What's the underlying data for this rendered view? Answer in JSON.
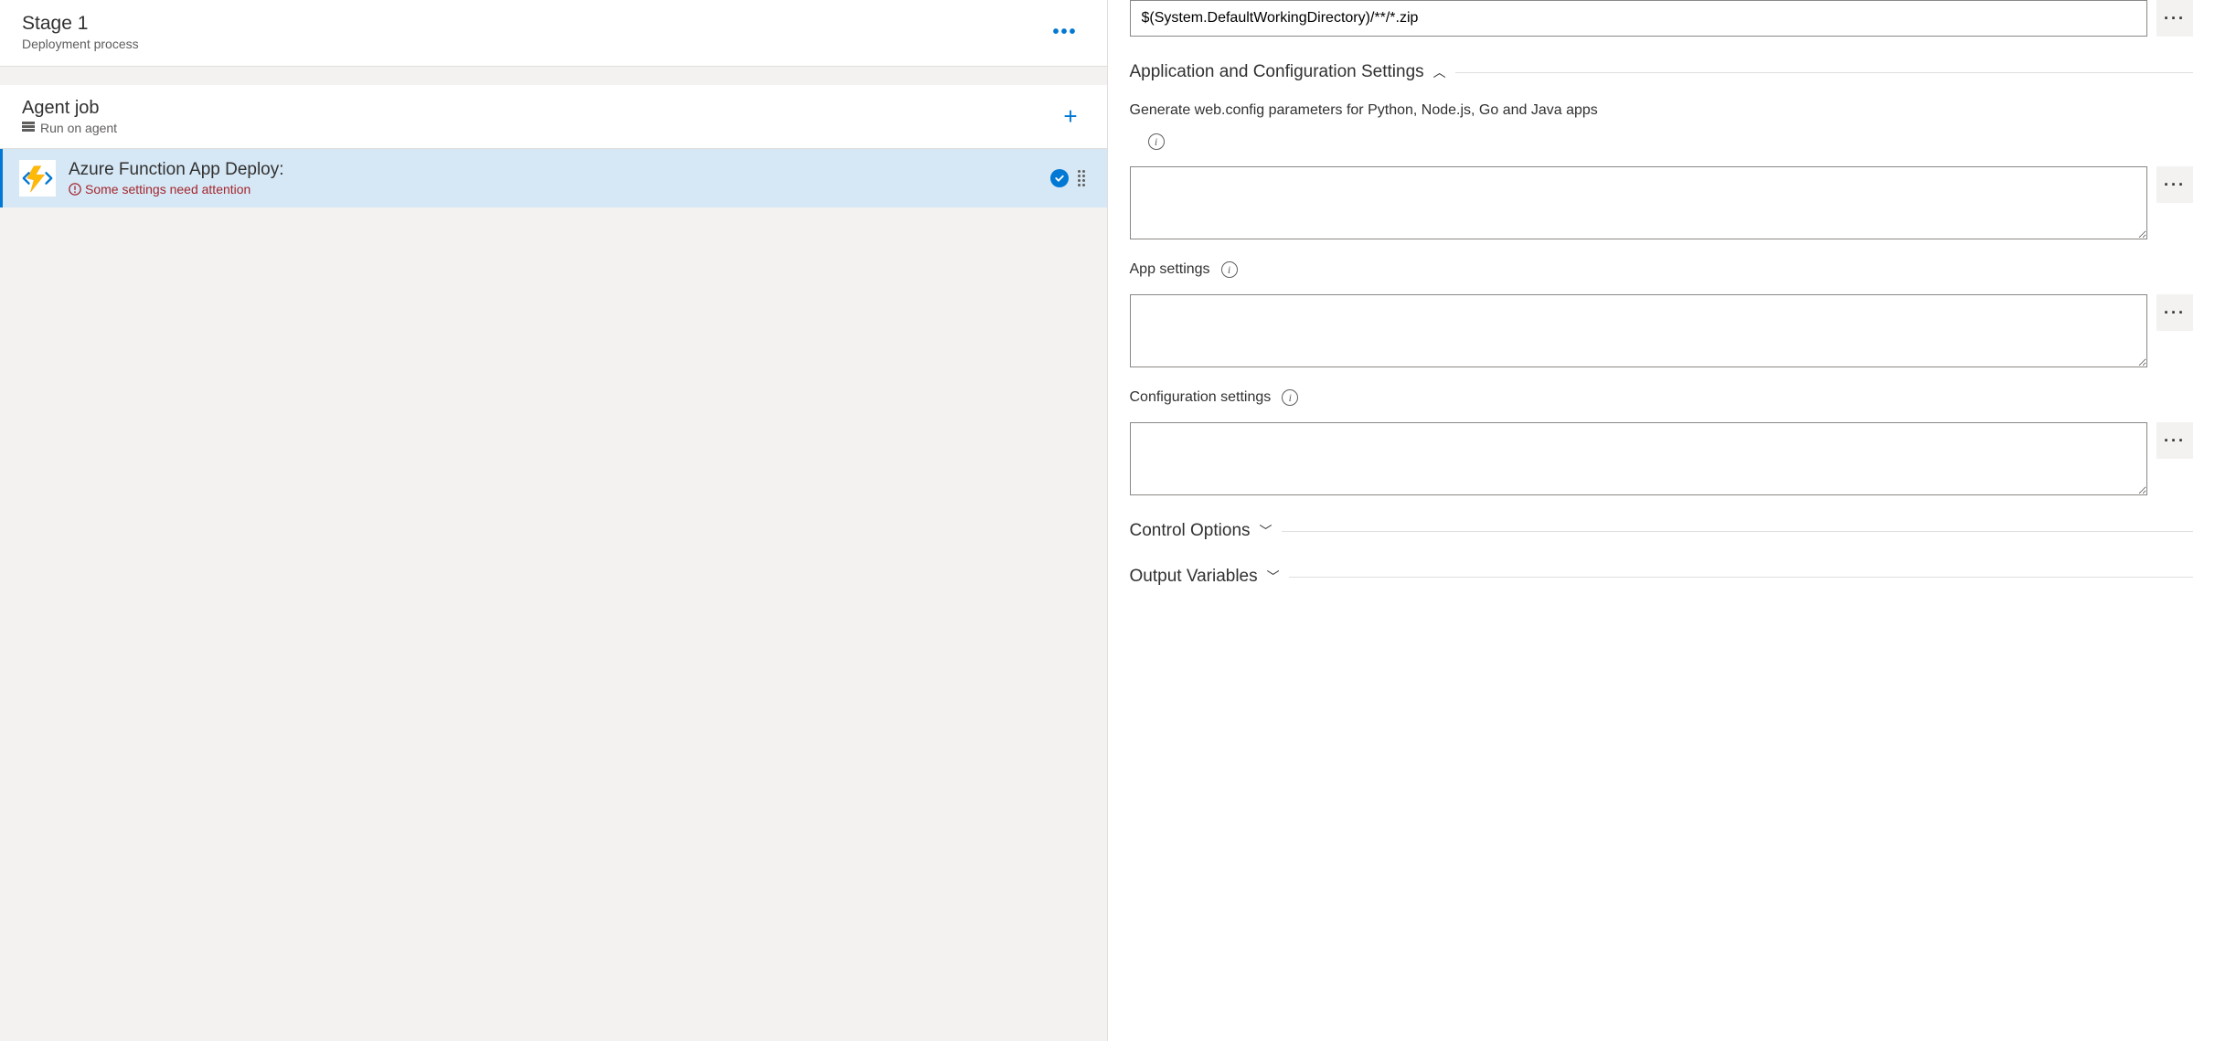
{
  "leftPanel": {
    "stage": {
      "title": "Stage 1",
      "subtitle": "Deployment process"
    },
    "agentJob": {
      "title": "Agent job",
      "subtitle": "Run on agent"
    },
    "task": {
      "title": "Azure Function App Deploy:",
      "warning": "Some settings need attention"
    }
  },
  "rightPanel": {
    "packagePath": "$(System.DefaultWorkingDirectory)/**/*.zip",
    "sections": {
      "appConfig": {
        "title": "Application and Configuration Settings",
        "webConfigLabel": "Generate web.config parameters for Python, Node.js, Go and Java apps",
        "webConfigValue": "",
        "appSettingsLabel": "App settings",
        "appSettingsValue": "",
        "configSettingsLabel": "Configuration settings",
        "configSettingsValue": ""
      },
      "controlOptions": {
        "title": "Control Options"
      },
      "outputVariables": {
        "title": "Output Variables"
      }
    }
  }
}
